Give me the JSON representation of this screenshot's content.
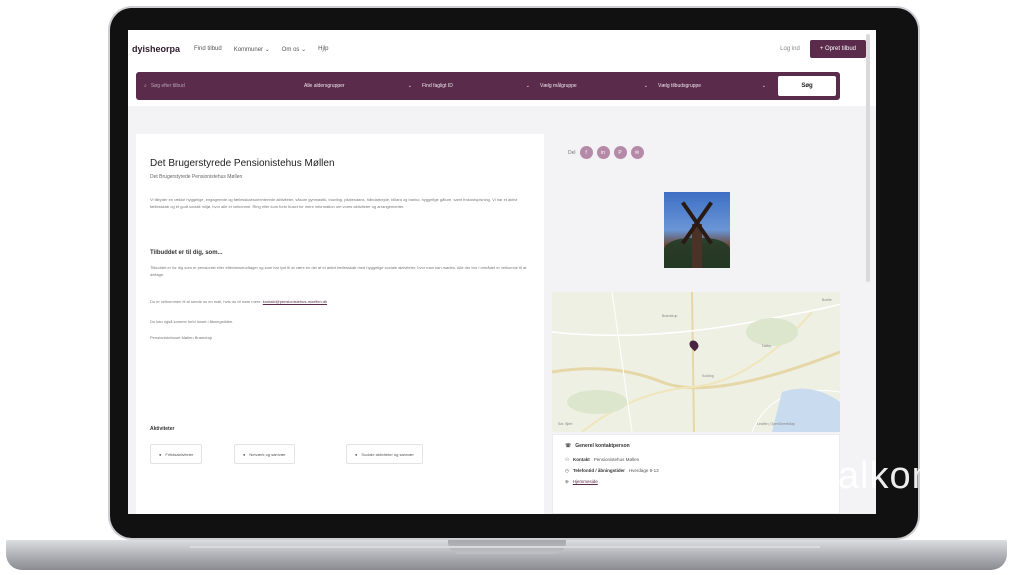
{
  "nav": {
    "logo": "dyisheorpa",
    "links": [
      "Find tilbud",
      "Kommuner ⌄",
      "Om os ⌄",
      "Hjlp"
    ],
    "login": "Log ind",
    "cta": "+ Opret tilbud"
  },
  "search": {
    "placeholder": "Søg efter tilbud",
    "selects": [
      "Alle aldersgrupper",
      "Find fagligt ID",
      "Vælg målgruppe",
      "Vælg tilbudsgruppe"
    ],
    "button": "Søg"
  },
  "detail": {
    "title": "Det Brugerstyrede Pensionistehus Møllen",
    "subtitle": "Det Brugerstyrede Pensionistehus Møllen",
    "intro": "Vi tilbyder en række hyggelige, engagerede og fællesskabsorienterede aktiviteter, såsom gymnastik, bowling, pilatesdans, håndarbejde, billard og banko, hyggelige gåture, samt frokostspisning. Vi har et aktivt fællesskab og et godt socialt miljø, hvor alle er velkomne. Ring eller kom forbi huset for mere information om vores aktiviteter og arrangementer.",
    "section_title": "Tilbuddet er til dig, som...",
    "section_text": "Tilbuddet er for dig som er pensionist eller efterlønsmodtager og som har lyst til at være en del af et aktivt fællesskab med hyggelige sociale aktiviteter, hvor man kan mødes. Alle der bor i området er velkomne til at deltage.",
    "email_text": "Du er velkommen til at sende os en mail, hvis du vil høre mere:",
    "email": "kontakt@pensionistehus-moellen.dk",
    "line2": "Du kan også komme forbi huset i åbningstiden.",
    "line3": "Pensionistehuset Møllen Bramdrup",
    "activities_label": "Aktiviteter",
    "chips": [
      "Fritidsaktiviteter",
      "Netværk og samvær",
      "Sociale aktiviteter og samvær"
    ]
  },
  "side": {
    "share_label": "Del",
    "share_icons": [
      "f",
      "in",
      "P",
      "✉"
    ],
    "map_labels": [
      "Boelle",
      "Bramdrup",
      "Dalby",
      "Kolding",
      "Sdr. Bjert",
      "Leaflet | OpenStreetMap"
    ],
    "contact_title": "Generel kontaktperson",
    "contact_rows": [
      {
        "label": "Kontakt",
        "value": "Pensionistehus Møllen"
      },
      {
        "label": "Telefontid / åbningstider",
        "value": "Hverdage 9-13"
      },
      {
        "label": "",
        "value": "Hjemmeside"
      }
    ]
  },
  "overlay": "Socialkom"
}
